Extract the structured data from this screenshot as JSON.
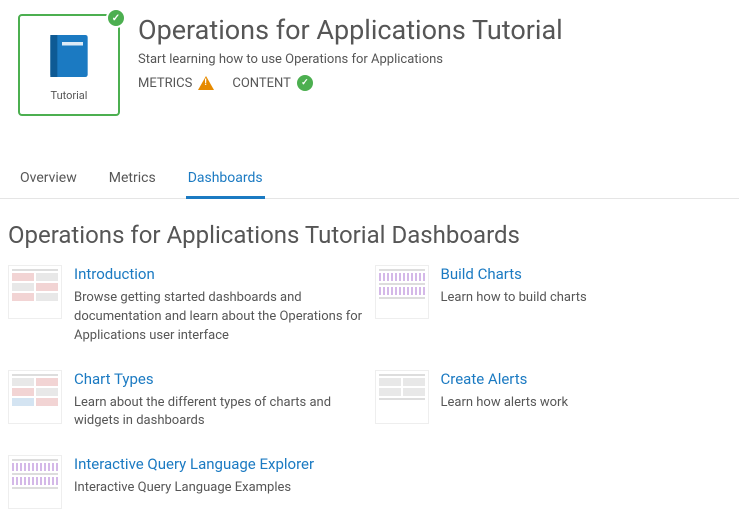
{
  "header": {
    "tile_label": "Tutorial",
    "title": "Operations for Applications Tutorial",
    "subtitle": "Start learning how to use Operations for Applications",
    "metrics_label": "METRICS",
    "content_label": "CONTENT"
  },
  "tabs": {
    "overview": "Overview",
    "metrics": "Metrics",
    "dashboards": "Dashboards"
  },
  "section_title": "Operations for Applications Tutorial Dashboards",
  "cards": [
    {
      "title": "Introduction",
      "desc": "Browse getting started dashboards and documentation and learn about the Operations for Applications user interface"
    },
    {
      "title": "Build Charts",
      "desc": "Learn how to build charts"
    },
    {
      "title": "Chart Types",
      "desc": "Learn about the different types of charts and widgets in dashboards"
    },
    {
      "title": "Create Alerts",
      "desc": "Learn how alerts work"
    },
    {
      "title": "Interactive Query Language Explorer",
      "desc": "Interactive Query Language Examples"
    }
  ]
}
